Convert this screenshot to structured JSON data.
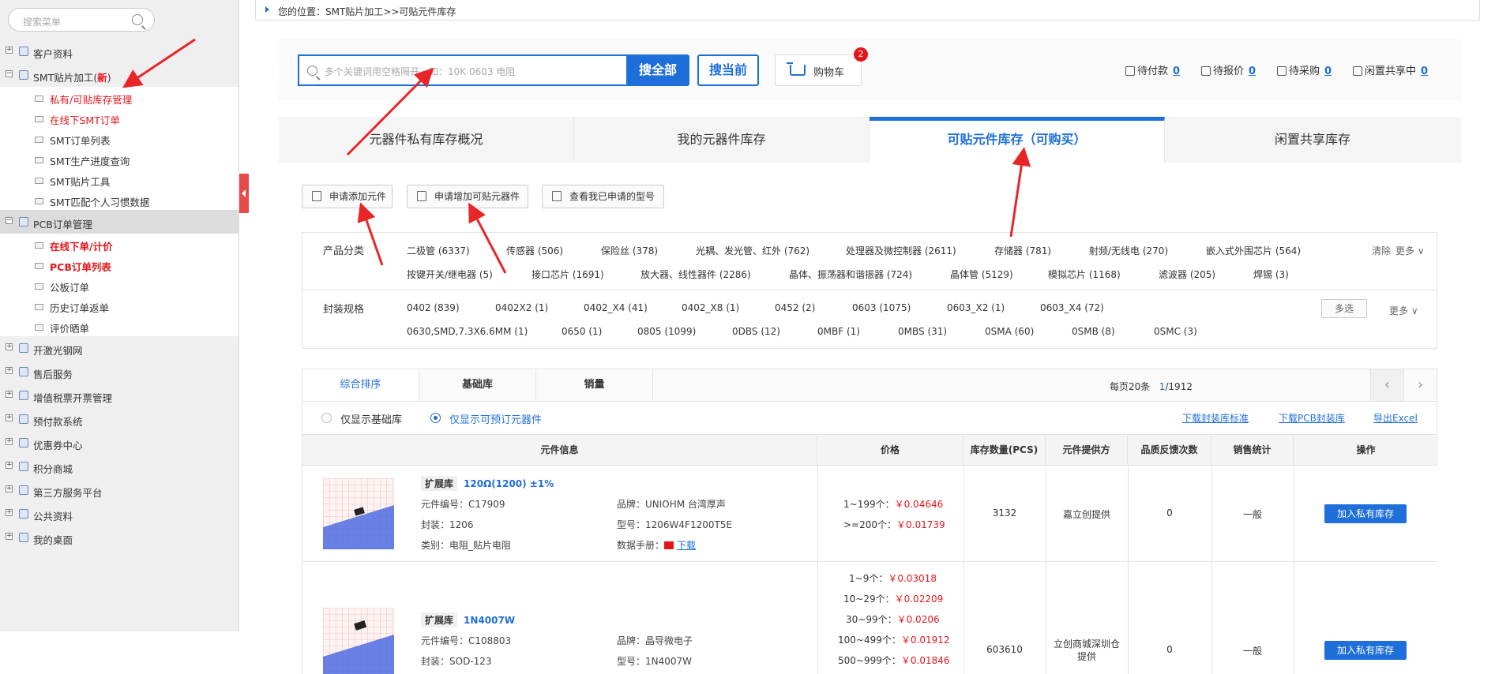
{
  "sidebar": {
    "search_placeholder": "搜索菜单",
    "groups": [
      {
        "label": "客户资料"
      },
      {
        "label": "SMT贴片加工(",
        "badge": "新",
        "badge_close": ")"
      },
      {
        "label": "PCB订单管理"
      },
      {
        "label": "开激光钢网"
      },
      {
        "label": "售后服务"
      },
      {
        "label": "增值税票开票管理"
      },
      {
        "label": "预付款系统"
      },
      {
        "label": "优惠券中心"
      },
      {
        "label": "积分商城"
      },
      {
        "label": "第三方服务平台"
      },
      {
        "label": "公共资料"
      },
      {
        "label": "我的桌面"
      }
    ],
    "smt_items": [
      "私有/可贴库存管理",
      "在线下SMT订单",
      "SMT订单列表",
      "SMT生产进度查询",
      "SMT贴片工具",
      "SMT匹配个人习惯数据"
    ],
    "pcb_items": [
      "在线下单/计价",
      "PCB订单列表",
      "公板订单",
      "历史订单返单",
      "评价晒单"
    ]
  },
  "breadcrumb": "您的位置：SMT贴片加工>>可贴元件库存",
  "search": {
    "placeholder": "多个关键词用空格隔开，如：10K 0603 电阻",
    "btn_all": "搜全部",
    "btn_current": "搜当前",
    "cart_label": "购物车",
    "cart_badge": "2"
  },
  "stats": [
    {
      "label": "待付款",
      "value": "0"
    },
    {
      "label": "待报价",
      "value": "0"
    },
    {
      "label": "待采购",
      "value": "0"
    },
    {
      "label": "闲置共享中",
      "value": "0"
    }
  ],
  "tabs": [
    "元器件私有库存概况",
    "我的元器件库存",
    "可贴元件库存（可购买）",
    "闲置共享库存"
  ],
  "action_buttons": [
    "申请添加元件",
    "申请增加可贴元器件",
    "查看我已申请的型号"
  ],
  "filters": {
    "category_title": "产品分类",
    "categories_row1": [
      "二极管 (6337)",
      "传感器 (506)",
      "保险丝 (378)",
      "光耦、发光管、红外 (762)",
      "处理器及微控制器 (2611)",
      "存储器 (781)",
      "射频/无线电 (270)",
      "嵌入式外围芯片 (564)"
    ],
    "categories_row2": [
      "按键开关/继电器 (5)",
      "接口芯片 (1691)",
      "放大器、线性器件 (2286)",
      "晶体、振荡器和谐振器 (724)",
      "晶体管 (5129)",
      "模拟芯片 (1168)",
      "滤波器 (205)",
      "焊锡 (3)"
    ],
    "clear": "清除",
    "more": "更多",
    "package_title": "封装规格",
    "packages_row1": [
      "0402 (839)",
      "0402X2 (1)",
      "0402_X4 (41)",
      "0402_X8 (1)",
      "0452 (2)",
      "0603 (1075)",
      "0603_X2 (1)",
      "0603_X4 (72)"
    ],
    "packages_row2": [
      "0630,SMD,7.3X6.6MM (1)",
      "0650 (1)",
      "0805 (1099)",
      "0DBS (12)",
      "0MBF (1)",
      "0MBS (31)",
      "0SMA (60)",
      "0SMB (8)",
      "0SMC (3)"
    ],
    "multi_select": "多选",
    "more2": "更多"
  },
  "sort": {
    "tabs": [
      "综合排序",
      "基础库",
      "销量"
    ],
    "per_page": "每页20条",
    "page_current": "1",
    "page_total": "/1912",
    "prev": "‹",
    "next": "›"
  },
  "options": {
    "radio1": "仅显示基础库",
    "radio2": "仅显示可预订元器件",
    "links": [
      "下载封装库标准",
      "下载PCB封装库",
      "导出Excel"
    ]
  },
  "table": {
    "headers": [
      "元件信息",
      "价格",
      "库存数量(PCS)",
      "元件提供方",
      "品质反馈次数",
      "销售统计",
      "操作"
    ],
    "rows": [
      {
        "tag": "扩展库",
        "name": "120Ω(1200) ±1%",
        "code": "元件编号：C17909",
        "brand": "品牌：UNIOHM 台湾厚声",
        "package": "封装：1206",
        "model": "型号：1206W4F1200T5E",
        "category": "类别：电阻_贴片电阻",
        "datasheet_label": "数据手册：",
        "datasheet_link": "下载",
        "prices": [
          {
            "range": "1~199个：",
            "price": "￥0.04646"
          },
          {
            "range": ">=200个：",
            "price": "￥0.01739"
          }
        ],
        "stock": "3132",
        "provider": "嘉立创提供",
        "feedback": "0",
        "sales": "一般",
        "action": "加入私有库存"
      },
      {
        "tag": "扩展库",
        "name": "1N4007W",
        "code": "元件编号：C108803",
        "brand": "品牌：晶导微电子",
        "package": "封装：SOD-123",
        "model": "型号：1N4007W",
        "prices": [
          {
            "range": "1~9个：",
            "price": "￥0.03018"
          },
          {
            "range": "10~29个：",
            "price": "￥0.02209"
          },
          {
            "range": "30~99个：",
            "price": "￥0.0206"
          },
          {
            "range": "100~499个：",
            "price": "￥0.01912"
          },
          {
            "range": "500~999个：",
            "price": "￥0.01846"
          }
        ],
        "stock": "603610",
        "provider": "立创商城深圳仓提供",
        "feedback": "0",
        "sales": "一般",
        "action": "加入私有库存"
      }
    ]
  },
  "colors": {
    "accent": "#1e6fd9",
    "red": "#e4161b",
    "annotation": "#e8262a"
  }
}
